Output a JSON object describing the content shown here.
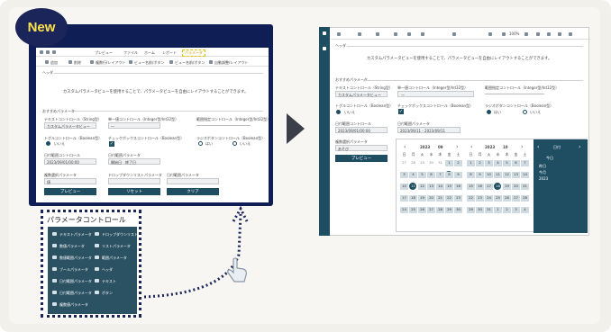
{
  "badge": {
    "label": "New"
  },
  "designer": {
    "menu": [
      "プレビュー",
      "ファイル",
      "ホーム",
      "レポート",
      "パラメータ"
    ],
    "toolbar": [
      "追加",
      "削除",
      "編集",
      "複数行/レイアウト",
      "ビュー名前/ボタン",
      "ビュー名前/ボタン",
      "自動調整/レイアウト"
    ],
    "header_label": "ヘッダ",
    "header_text": "カスタムパラメータビューを使用することで、パラメータビューを自由にレイアウトすることができます。",
    "params_label": "おすすめパラメータ",
    "fields": {
      "text": "テキストコントロール（String型）",
      "single": "単一値コントロール（Integer型/Int32型）",
      "range": "範囲指定コントロール（Integer型/Int32型）",
      "toggle": "トグルコントロール（Boolean型）",
      "checkbox": "チェックボックスコントロール（Boolean型）",
      "radio": "ラジオボタンコントロール（Boolean型）",
      "date": "日付範囲コントロール",
      "dateval": "日付範囲パラメータ",
      "multi": "複数選択パラメータ",
      "dropdown": "ドロップダウンリストパラメータ",
      "date2": "日付範囲パラメータ"
    },
    "values": {
      "text": "カスタムパラメータビュー",
      "single": "一",
      "toggle": "いいえ",
      "radio_yes": "はい",
      "radio_no": "いいえ",
      "date": "2023/09/01/00:00",
      "dateval": "開始日　終了日",
      "select": "値"
    },
    "buttons": [
      "プレビュー",
      "リセット",
      "クリア"
    ]
  },
  "palette": {
    "title": "パラメータコントロール",
    "items_left": [
      "テキストパラメータ",
      "数値パラメータ",
      "数値範囲パラメータ",
      "ブールパラメータ",
      "日付範囲パラメータ",
      "日付範囲パラメータ",
      "複数値パラメータ"
    ],
    "items_right": [
      "ドロップダウンリスト",
      "リストパラメータ",
      "範囲パラメータ",
      "ヘッダ",
      "テキスト",
      "ボタン"
    ]
  },
  "preview": {
    "header_label": "ヘッダ",
    "header_text": "カスタムパラメータビューを使用することで、パラメータビューを自由にレイアウトすることができます。",
    "params_label": "おすすめパラメータ",
    "fields": {
      "text": "テキストコントロール（String型）",
      "single": "単一値コントロール（Integer型/Int32型）",
      "range": "範囲指定コントロール（Integer型/Int32型）",
      "toggle": "トグルコントロール（Boolean型）",
      "checkbox": "チェックボックスコントロール（Boolean型）",
      "radio": "ラジオボタンコントロール（Boolean型）",
      "date": "日付範囲コントロール",
      "dateval": "日付範囲パラメータ",
      "multi": "複数選択パラメータ"
    },
    "values": {
      "text": "カスタムパラメータビュー",
      "single": "一",
      "toggle": "いいえ",
      "radio_yes": "はい",
      "radio_no": "いいえ",
      "date": "2023/09/01/00:00",
      "dateval": "2023/09/11 - 2023/09/11",
      "select": "あそび"
    },
    "zoom": "100%",
    "preview_button": "プレビュー",
    "calendar": {
      "left_year": "2023",
      "left_month": "09",
      "right_year": "2023",
      "right_month": "10",
      "dow": [
        "日",
        "月",
        "火",
        "水",
        "木",
        "金",
        "土"
      ],
      "left_days": [
        "27",
        "28",
        "29",
        "30",
        "31",
        "1",
        "2",
        "3",
        "4",
        "5",
        "6",
        "7",
        "8",
        "9",
        "10",
        "11",
        "12",
        "13",
        "14",
        "15",
        "16",
        "17",
        "18",
        "19",
        "20",
        "21",
        "22",
        "23",
        "24",
        "25",
        "26",
        "27",
        "28",
        "29",
        "30"
      ],
      "right_days": [
        "1",
        "2",
        "3",
        "4",
        "5",
        "6",
        "7",
        "8",
        "9",
        "10",
        "11",
        "12",
        "13",
        "14",
        "15",
        "16",
        "17",
        "18",
        "19",
        "20",
        "21",
        "22",
        "23",
        "24",
        "25",
        "26",
        "27",
        "28",
        "29",
        "30",
        "31",
        "1",
        "2",
        "3",
        "4"
      ],
      "side_title": "日付",
      "side_items": [
        "今日",
        "昨日",
        "今月",
        "2023"
      ]
    }
  }
}
